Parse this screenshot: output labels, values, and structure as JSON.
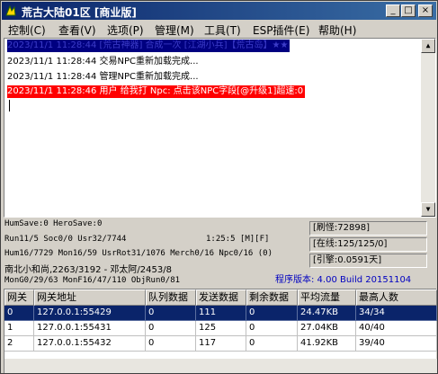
{
  "window": {
    "title": "荒古大陆01区 [商业版]"
  },
  "title_buttons": {
    "minimize": "_",
    "maximize": "□",
    "close": "×"
  },
  "menu": [
    {
      "label": "控制(C)"
    },
    {
      "label": "查看(V)"
    },
    {
      "label": "选项(P)"
    },
    {
      "label": "管理(M)"
    },
    {
      "label": "工具(T)"
    },
    {
      "label": "ESP插件(E)"
    },
    {
      "label": "帮助(H)"
    }
  ],
  "log": [
    {
      "text": "2023/11/1 11:28:44 [荒古神器] 合成一次  [江湖小兵]【荒古岛】★★"
    },
    {
      "text": "2023/11/1 11:28:44 交易NPC重新加载完成..."
    },
    {
      "text": "2023/11/1 11:28:44 管理NPC重新加载完成..."
    },
    {
      "text": "2023/11/1 11:28:46 用户 给我打 Npc:   点击该NPC字段[@升级1]超速:0"
    }
  ],
  "status": {
    "line1": "HumSave:0 HeroSave:0",
    "line2": "Run11/5 Soc0/0 Usr32/7744",
    "line2_time": "1:25:5 [M][F]",
    "line3": "Hum16/7729 Mon16/59 UsrRot31/1076 Merch0/16 Npc0/16 (0)",
    "line4": "南北小和尚,2263/3192 - 邓太阿/2453/8",
    "line5": "MonG0/29/63 MonF16/47/110 ObjRun0/81",
    "refresh": "[刷怪:72898]",
    "online": "[在线:125/125/0]",
    "engine": "[引擎:0.0591天]",
    "version": "程序版本: 4.00 Build 20151104"
  },
  "table": {
    "columns": [
      "网关",
      "网关地址",
      "队列数据",
      "发送数据",
      "剩余数据",
      "平均流量",
      "最高人数"
    ],
    "rows": [
      [
        "0",
        "127.0.0.1:55429",
        "0",
        "111",
        "0",
        "24.47KB",
        "34/34"
      ],
      [
        "1",
        "127.0.0.1:55431",
        "0",
        "125",
        "0",
        "27.04KB",
        "40/40"
      ],
      [
        "2",
        "127.0.0.1:55432",
        "0",
        "117",
        "0",
        "41.92KB",
        "39/40"
      ]
    ],
    "selected_row": 0
  },
  "colors": {
    "title_bar": "#0a246a",
    "error_line": "#ff0000",
    "version_text": "#0000c0",
    "selection": "#0a246a"
  },
  "icons": [
    "app-icon",
    "minimize-icon",
    "maximize-icon",
    "close-icon",
    "scroll-up-icon",
    "scroll-down-icon"
  ]
}
